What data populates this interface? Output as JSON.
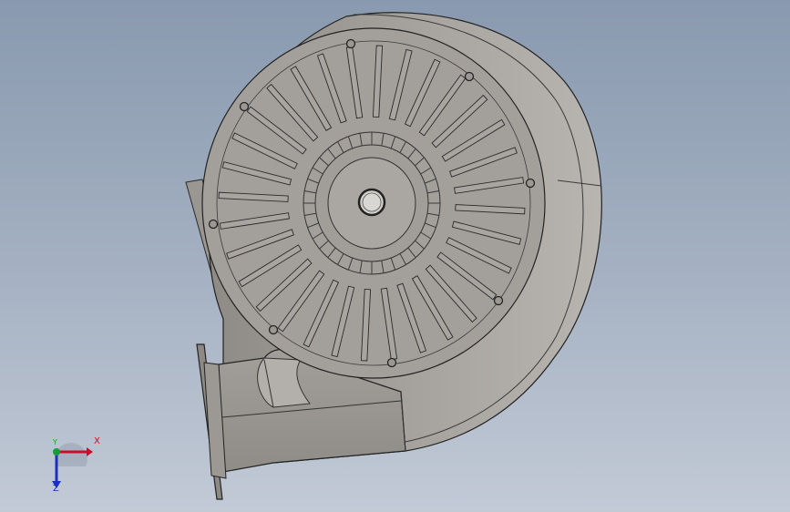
{
  "viewport": {
    "background_top": "#8999af",
    "background_bottom": "#c2cad6",
    "model": "centrifugal-blower-housing",
    "part_color": "#a7a49f"
  },
  "triad": {
    "x_label": "X",
    "y_label": "Y",
    "z_label": "Z",
    "x_color": "#c8102e",
    "y_color": "#1a9a3a",
    "z_color": "#1a2fc8"
  }
}
